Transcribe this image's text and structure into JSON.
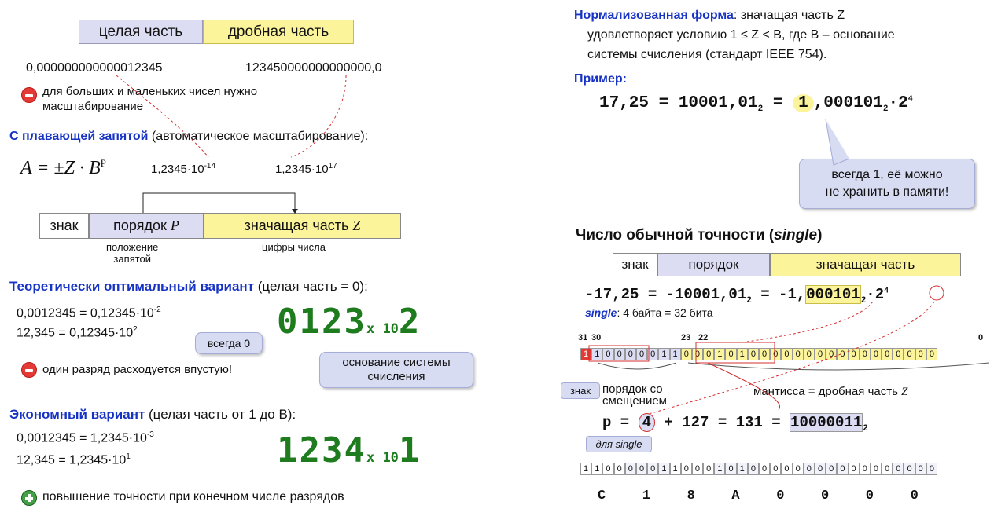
{
  "left": {
    "header_int": "целая часть",
    "header_frac": "дробная часть",
    "small_num": "0,000000000000012345",
    "big_num": "123450000000000000,0",
    "problem_text_1": "для больших и маленьких чисел нужно",
    "problem_text_2": "масштабирование",
    "float_title": "С плавающей запятой",
    "float_title_rest": " (автоматическое масштабирование):",
    "formula": "A = ±Z · B",
    "formula_sup": "P",
    "example1": "1,2345·10",
    "example1_exp": "-14",
    "example2": "1,2345·10",
    "example2_exp": "17",
    "layout_sign": "знак",
    "layout_order": "порядок ",
    "layout_order_var": "P",
    "layout_mant": "значащая часть ",
    "layout_mant_var": "Z",
    "caption_pos_1": "положение",
    "caption_pos_2": "запятой",
    "caption_digits": "цифры числа",
    "theory_title": "Теоретически оптимальный вариант",
    "theory_rest": " (целая часть = 0):",
    "theory_eq1": "0,0012345 = 0,12345·10",
    "theory_eq1_exp": "-2",
    "theory_eq2": "12,345 = 0,12345·10",
    "theory_eq2_exp": "2",
    "always0": "всегда 0",
    "lcd1_digits": "0123",
    "lcd1_exp": "2",
    "lcd_x10": "x 10",
    "waste_text": "один разряд расходуется впустую!",
    "base_callout_1": "основание системы",
    "base_callout_2": "счисления",
    "econ_title": "Экономный вариант",
    "econ_rest": " (целая часть от 1 до B):",
    "econ_eq1": "0,0012345 = 1,2345·10",
    "econ_eq1_exp": "-3",
    "econ_eq2": "12,345 = 1,2345·10",
    "econ_eq2_exp": "1",
    "lcd2_digits": "1234",
    "lcd2_exp": "1",
    "plus_text": "повышение точности при конечном числе разрядов"
  },
  "right": {
    "norm_title": "Нормализованная форма",
    "norm_text_1": ": значащая часть Z",
    "norm_text_2": "удовлетворяет условию 1 ≤ Z < B, где B – основание",
    "norm_text_3": "системы счисления (стандарт IEEE 754).",
    "example_title": "Пример",
    "example_left": "17,25 = 10001,01",
    "example_sub": "2",
    "example_eq": " = ",
    "example_one": "1",
    "example_rest": ",000101",
    "example_rest_sub": "2",
    "example_pow": "·2",
    "example_pow_exp": "4",
    "always1_1": "всегда 1, её можно",
    "always1_2": "не хранить в памяти!",
    "single_title": "Число обычной точности (",
    "single_word": "single",
    "single_close": ")",
    "hdr_sign": "знак",
    "hdr_order": "порядок",
    "hdr_mant": "значащая часть",
    "neg_left": "-17,25 = -10001,01",
    "neg_sub": "2",
    "neg_mid": " = -1,",
    "neg_mant": "000101",
    "neg_mant_sub": "2",
    "neg_pow": "·2",
    "neg_pow_exp": "4",
    "single_label": "single",
    "single_size": ": 4 байта = 32 бита",
    "bit31": "31",
    "bit30": "30",
    "bit23": "23",
    "bit22": "22",
    "bit0": "0",
    "bits": [
      "1",
      "1",
      "0",
      "0",
      "0",
      "0",
      "0",
      "1",
      "1",
      "0",
      "0",
      "0",
      "1",
      "0",
      "1",
      "0",
      "0",
      "0",
      "0",
      "0",
      "0",
      "0",
      "0",
      "0",
      "0",
      "0",
      "0",
      "0",
      "0",
      "0",
      "0",
      "0"
    ],
    "sign_tag": "знак",
    "order_offset_1": "порядок со",
    "order_offset_2": "смещением",
    "mantissa_label": "мантисса = дробная часть ",
    "mantissa_var": "Z",
    "p_label": "p = ",
    "p_four": "4",
    "p_rest": " + 127 = 131 = ",
    "p_bin": "10000011",
    "p_bin_sub": "2",
    "for_single": "для single",
    "bits2": [
      "1",
      "1",
      "0",
      "0",
      "0",
      "0",
      "0",
      "1",
      "1",
      "0",
      "0",
      "0",
      "1",
      "0",
      "1",
      "0",
      "0",
      "0",
      "0",
      "0",
      "0",
      "0",
      "0",
      "0",
      "0",
      "0",
      "0",
      "0",
      "0",
      "0",
      "0",
      "0"
    ],
    "hex": [
      "C",
      "1",
      "8",
      "A",
      "0",
      "0",
      "0",
      "0"
    ]
  }
}
